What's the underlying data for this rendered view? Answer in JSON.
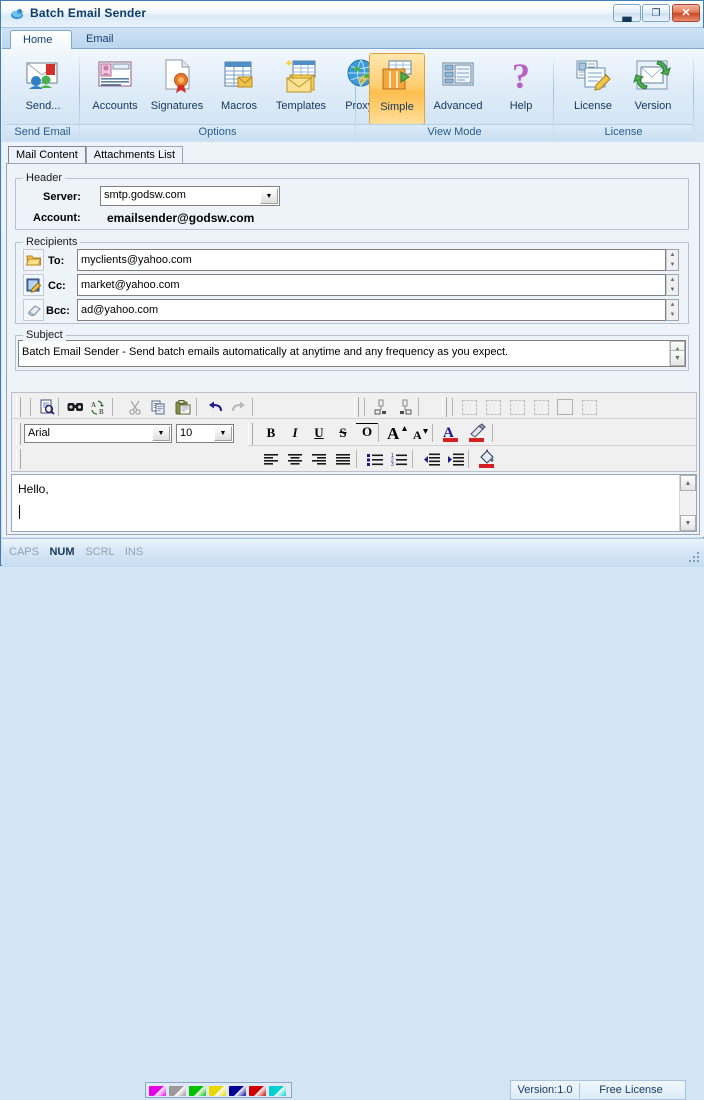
{
  "window": {
    "title": "Batch Email Sender",
    "app_icon": "bird-icon",
    "buttons": {
      "minimize": "minimize-icon",
      "maximize": "maximize-icon",
      "close": "✕"
    }
  },
  "ribbon": {
    "tabs": [
      {
        "label": "Home",
        "active": true
      },
      {
        "label": "Email",
        "active": false
      }
    ],
    "groups": [
      {
        "label": "Send Email",
        "buttons": [
          {
            "label": "Send...",
            "icon": "send-mail-icon",
            "selected": false
          }
        ]
      },
      {
        "label": "Options",
        "buttons": [
          {
            "label": "Accounts",
            "icon": "accounts-icon",
            "selected": false
          },
          {
            "label": "Signatures",
            "icon": "signatures-icon",
            "selected": false
          },
          {
            "label": "Macros",
            "icon": "macros-icon",
            "selected": false
          },
          {
            "label": "Templates",
            "icon": "templates-icon",
            "selected": false
          },
          {
            "label": "Proxys",
            "icon": "proxys-globe-icon",
            "selected": false
          }
        ]
      },
      {
        "label": "View Mode",
        "buttons": [
          {
            "label": "Simple",
            "icon": "simple-view-icon",
            "selected": true
          },
          {
            "label": "Advanced",
            "icon": "advanced-view-icon",
            "selected": false
          },
          {
            "label": "Help",
            "icon": "help-question-icon",
            "selected": false
          }
        ]
      },
      {
        "label": "License",
        "buttons": [
          {
            "label": "License",
            "icon": "license-icon",
            "selected": false
          },
          {
            "label": "Version",
            "icon": "version-icon",
            "selected": false
          }
        ]
      }
    ]
  },
  "content_tabs": [
    {
      "label": "Mail Content",
      "active": true
    },
    {
      "label": "Attachments List",
      "active": false
    }
  ],
  "header": {
    "group_title": "Header",
    "server_label": "Server:",
    "server_value": "smtp.godsw.com",
    "account_label": "Account:",
    "account_value": "emailsender@godsw.com"
  },
  "recipients": {
    "group_title": "Recipients",
    "rows": [
      {
        "icon": "open-folder-icon",
        "label": "To:",
        "value": "myclients@yahoo.com"
      },
      {
        "icon": "edit-list-icon",
        "label": "Cc:",
        "value": "market@yahoo.com"
      },
      {
        "icon": "eraser-icon",
        "label": "Bcc:",
        "value": "ad@yahoo.com"
      }
    ]
  },
  "subject": {
    "group_title": "Subject",
    "value": "Batch Email Sender - Send batch emails automatically at anytime and any frequency as you expect."
  },
  "format_toolbar": {
    "row1": [
      {
        "icon": "print-preview-icon"
      },
      {
        "icon": "find-icon"
      },
      {
        "icon": "replace-icon"
      },
      {
        "icon": "cut-icon"
      },
      {
        "icon": "copy-icon"
      },
      {
        "icon": "paste-icon"
      },
      {
        "icon": "undo-icon"
      },
      {
        "icon": "redo-icon"
      },
      {
        "icon": "insert-anchor-icon"
      },
      {
        "icon": "insert-bookmark-icon"
      },
      {
        "icon": "border-none-icon"
      },
      {
        "icon": "border-left-icon"
      },
      {
        "icon": "border-right-icon"
      },
      {
        "icon": "border-top-icon"
      },
      {
        "icon": "border-all-icon"
      },
      {
        "icon": "border-inside-icon"
      }
    ],
    "font_name": "Arial",
    "font_size": "10",
    "row2": [
      {
        "icon": "bold-icon",
        "glyph": "B"
      },
      {
        "icon": "italic-icon",
        "glyph": "I"
      },
      {
        "icon": "underline-icon",
        "glyph": "U"
      },
      {
        "icon": "strikethrough-icon",
        "glyph": "S"
      },
      {
        "icon": "overline-icon",
        "glyph": "O"
      },
      {
        "icon": "grow-font-icon",
        "glyph": "A"
      },
      {
        "icon": "shrink-font-icon",
        "glyph": "A"
      },
      {
        "icon": "font-color-icon",
        "glyph": "A"
      },
      {
        "icon": "highlight-icon",
        "glyph": "✎"
      }
    ],
    "row3": [
      {
        "icon": "align-left-icon"
      },
      {
        "icon": "align-center-icon"
      },
      {
        "icon": "align-right-icon"
      },
      {
        "icon": "align-justify-icon"
      },
      {
        "icon": "bullet-list-icon"
      },
      {
        "icon": "numbered-list-icon"
      },
      {
        "icon": "decrease-indent-icon"
      },
      {
        "icon": "increase-indent-icon"
      },
      {
        "icon": "fill-color-icon"
      }
    ]
  },
  "body": {
    "text": "Hello,"
  },
  "statusbar": {
    "indicators": [
      {
        "label": "CAPS",
        "active": false
      },
      {
        "label": "NUM",
        "active": true
      },
      {
        "label": "SCRL",
        "active": false
      },
      {
        "label": "INS",
        "active": false
      }
    ],
    "colors": [
      "#e800e8",
      "#9a9a9a",
      "#00c000",
      "#e8d800",
      "#000098",
      "#d00000",
      "#00d0d0"
    ],
    "version": "Version:1.0",
    "license": "Free License"
  }
}
